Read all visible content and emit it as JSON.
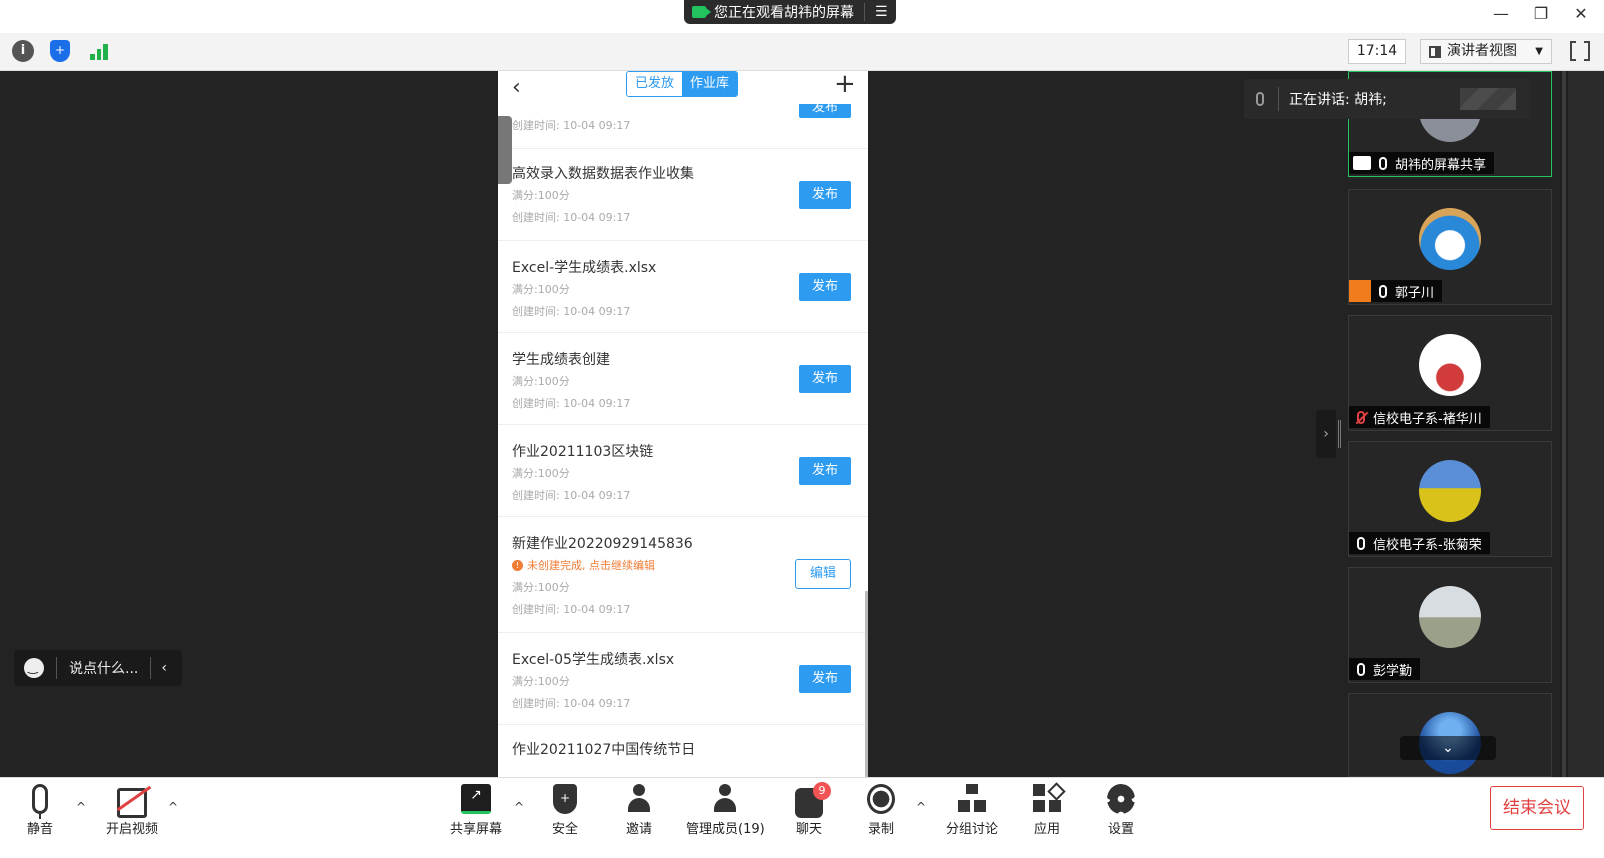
{
  "window": {
    "share_status": "您正在观看胡祎的屏幕",
    "controls": [
      "—",
      "❐",
      "✕"
    ]
  },
  "topbar": {
    "time": "17:14",
    "view_mode": "演讲者视图"
  },
  "phone": {
    "tab_published": "已发放",
    "tab_library": "作业库",
    "top_partial": {
      "created": "创建时间: 10-04 09:17",
      "button": "发布"
    },
    "items": [
      {
        "title": "高效录入数据数据表作业收集",
        "score": "满分:100分",
        "created": "创建时间: 10-04 09:17",
        "button": "发布"
      },
      {
        "title": "Excel-学生成绩表.xlsx",
        "score": "满分:100分",
        "created": "创建时间: 10-04 09:17",
        "button": "发布"
      },
      {
        "title": "学生成绩表创建",
        "score": "满分:100分",
        "created": "创建时间: 10-04 09:17",
        "button": "发布"
      },
      {
        "title": "作业20211103区块链",
        "score": "满分:100分",
        "created": "创建时间: 10-04 09:17",
        "button": "发布"
      },
      {
        "title": "新建作业20220929145836",
        "warning": "未创建完成, 点击继续编辑",
        "score": "满分:100分",
        "created": "创建时间: 10-04 09:17",
        "button": "编辑"
      },
      {
        "title": "Excel-05学生成绩表.xlsx",
        "score": "满分:100分",
        "created": "创建时间: 10-04 09:17",
        "button": "发布"
      },
      {
        "title": "作业20211027中国传统节日"
      }
    ]
  },
  "chat": {
    "placeholder": "说点什么..."
  },
  "speaking": {
    "label": "正在讲话: 胡祎;"
  },
  "participants": [
    {
      "name": "胡祎的屏幕共享",
      "muted": false
    },
    {
      "name": "郭子川",
      "muted": false
    },
    {
      "name": "信校电子系-褚华川",
      "muted": true
    },
    {
      "name": "信校电子系-张菊荣",
      "muted": false
    },
    {
      "name": "彭学勤",
      "muted": false
    }
  ],
  "toolbar": {
    "mute": "静音",
    "video": "开启视频",
    "share": "共享屏幕",
    "security": "安全",
    "invite": "邀请",
    "members": "管理成员(19)",
    "chat": "聊天",
    "chat_badge": "9",
    "record": "录制",
    "breakout": "分组讨论",
    "apps": "应用",
    "settings": "设置",
    "end": "结束会议"
  },
  "colors": {
    "accent": "#2d9bf0",
    "warning": "#f07c36",
    "end": "#e04040",
    "active_tile": "#23c45e"
  }
}
